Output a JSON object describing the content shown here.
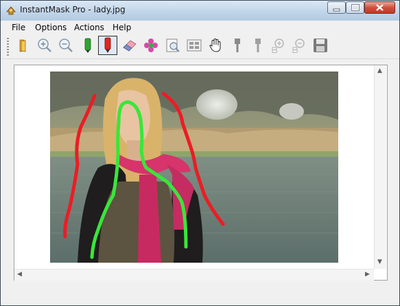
{
  "window": {
    "title": "InstantMask Pro - lady.jpg"
  },
  "menu": [
    "File",
    "Options",
    "Actions",
    "Help"
  ],
  "toolbar": {
    "tools": [
      {
        "name": "open-folder-icon",
        "active": false
      },
      {
        "name": "zoom-in-icon",
        "active": false
      },
      {
        "name": "zoom-out-icon",
        "active": false
      },
      {
        "name": "green-marker-icon",
        "active": false
      },
      {
        "name": "red-marker-icon",
        "active": true
      },
      {
        "name": "eraser-icon",
        "active": false
      },
      {
        "name": "flower-icon",
        "active": false
      },
      {
        "name": "preview-icon",
        "active": false
      },
      {
        "name": "grid-view-icon",
        "active": false
      },
      {
        "name": "hand-pan-icon",
        "active": false
      },
      {
        "name": "brush-icon",
        "active": false
      },
      {
        "name": "brush-alt-icon",
        "active": false
      },
      {
        "name": "zoom-in-b-icon",
        "active": false
      },
      {
        "name": "zoom-out-b-icon",
        "active": false
      },
      {
        "name": "save-disk-icon",
        "active": false
      }
    ]
  },
  "colors": {
    "keep_stroke": "#39e63a",
    "drop_stroke": "#ec1c24"
  }
}
